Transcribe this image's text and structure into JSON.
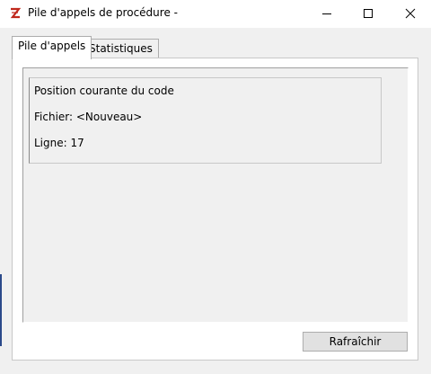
{
  "window": {
    "title": "Pile d'appels de procédure -",
    "icon": "app-logo-icon",
    "controls": {
      "minimize": "minimize-icon",
      "maximize": "maximize-icon",
      "close": "close-icon"
    }
  },
  "tabs": [
    {
      "label": "Pile d'appels",
      "active": true
    },
    {
      "label": "Statistiques",
      "active": false
    }
  ],
  "info": {
    "heading": "Position courante du code",
    "file_line": "Fichier: <Nouveau>",
    "line_line": "Ligne: 17"
  },
  "buttons": {
    "refresh_label": "Rafraîchir"
  },
  "colors": {
    "app_icon": "#c0281c",
    "window_bg": "#f0f0f0",
    "button_bg": "#e1e1e1"
  }
}
